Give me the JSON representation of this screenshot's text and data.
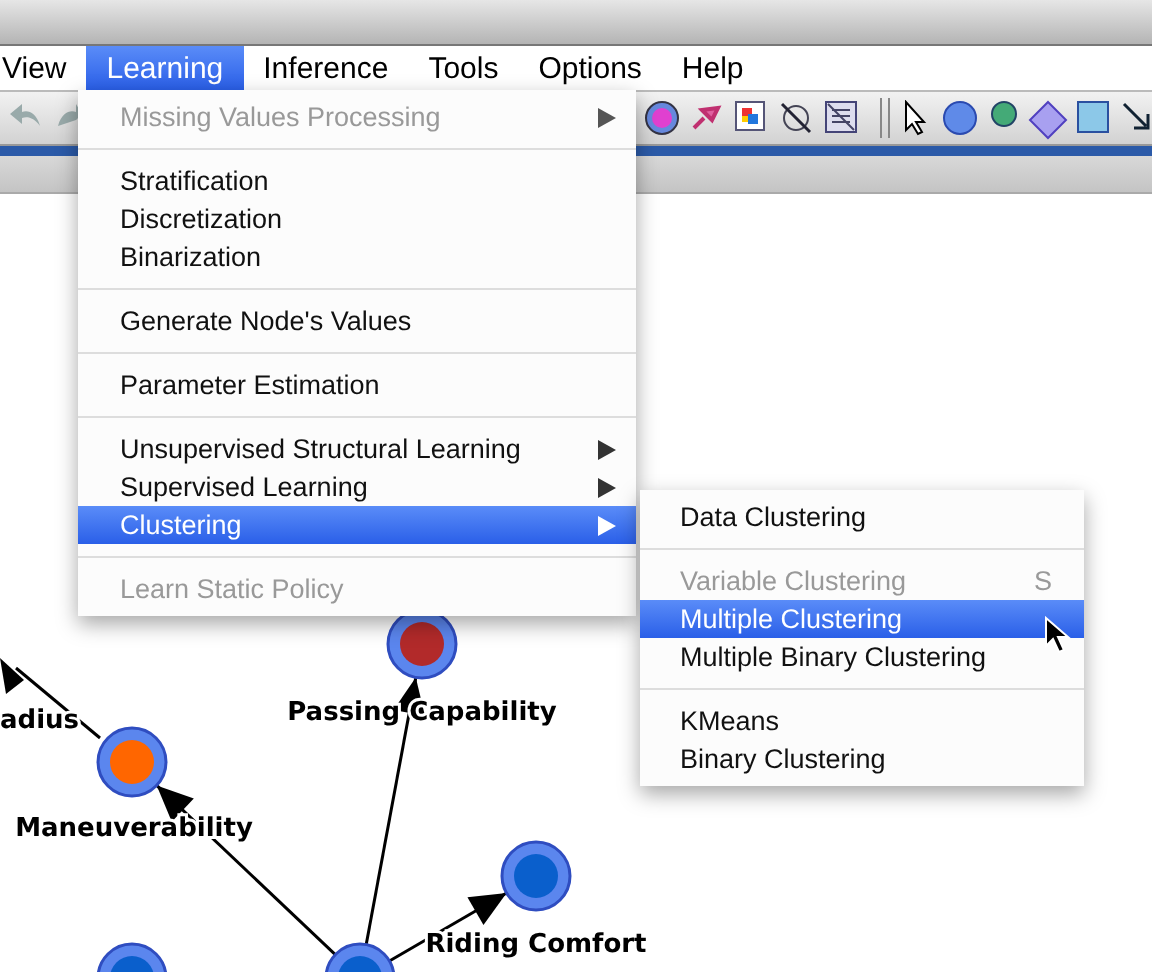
{
  "menubar": [
    {
      "label": "View",
      "selected": false
    },
    {
      "label": "Learning",
      "selected": true
    },
    {
      "label": "Inference",
      "selected": false
    },
    {
      "label": "Tools",
      "selected": false
    },
    {
      "label": "Options",
      "selected": false
    },
    {
      "label": "Help",
      "selected": false
    }
  ],
  "learning_menu": {
    "groups": [
      [
        {
          "label": "Missing Values Processing",
          "disabled": true,
          "selected": false,
          "submenu": true
        }
      ],
      [
        {
          "label": "Stratification",
          "disabled": false,
          "selected": false,
          "submenu": false
        },
        {
          "label": "Discretization",
          "disabled": false,
          "selected": false,
          "submenu": false
        },
        {
          "label": "Binarization",
          "disabled": false,
          "selected": false,
          "submenu": false
        }
      ],
      [
        {
          "label": "Generate Node's Values",
          "disabled": false,
          "selected": false,
          "submenu": false
        }
      ],
      [
        {
          "label": "Parameter Estimation",
          "disabled": false,
          "selected": false,
          "submenu": false
        }
      ],
      [
        {
          "label": "Unsupervised Structural Learning",
          "disabled": false,
          "selected": false,
          "submenu": true
        },
        {
          "label": "Supervised Learning",
          "disabled": false,
          "selected": false,
          "submenu": true
        },
        {
          "label": "Clustering",
          "disabled": false,
          "selected": true,
          "submenu": true
        }
      ],
      [
        {
          "label": "Learn Static Policy",
          "disabled": true,
          "selected": false,
          "submenu": false
        }
      ]
    ]
  },
  "clustering_submenu": {
    "groups": [
      [
        {
          "label": "Data Clustering",
          "disabled": false,
          "selected": false
        }
      ],
      [
        {
          "label": "Variable Clustering",
          "disabled": true,
          "selected": false,
          "shortcut": "S"
        },
        {
          "label": "Multiple Clustering",
          "disabled": false,
          "selected": true
        },
        {
          "label": "Multiple Binary Clustering",
          "disabled": false,
          "selected": false
        }
      ],
      [
        {
          "label": "KMeans",
          "disabled": false,
          "selected": false
        },
        {
          "label": "Binary Clustering",
          "disabled": false,
          "selected": false
        }
      ]
    ]
  },
  "graph": {
    "nodes": [
      {
        "label": "Passing Capability",
        "color": "#b22a2a"
      },
      {
        "label": "Maneuverability",
        "color": "#ff6600"
      },
      {
        "label": "Riding Comfort",
        "color": "#0a5fcc"
      },
      {
        "color": "#0a5fcc"
      },
      {
        "color": "#0a5fcc"
      }
    ],
    "labels": [
      {
        "label": "adius"
      }
    ]
  }
}
